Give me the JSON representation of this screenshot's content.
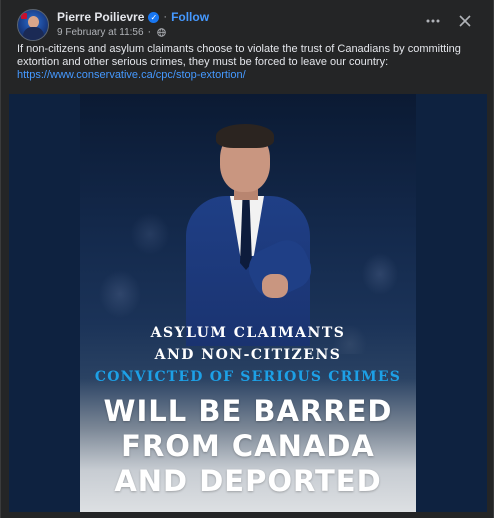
{
  "post": {
    "author": "Pierre Poilievre",
    "follow_label": "Follow",
    "date": "9 February at 11:56",
    "meta_separator": "·",
    "body_text": "If non-citizens and asylum claimants choose to violate the trust of Canadians by committing extortion and other serious crimes, they must be forced to leave our country:",
    "link": "https://www.conservative.ca/cpc/stop-extortion/"
  },
  "poster": {
    "line1": "ASYLUM CLAIMANTS",
    "line2": "AND NON-CITIZENS",
    "line3": "CONVICTED OF SERIOUS CRIMES",
    "line4": "WILL BE BARRED",
    "line5": "FROM CANADA",
    "line6": "AND DEPORTED"
  },
  "icons": {
    "more": "more-options-icon",
    "close": "close-icon",
    "verified": "verified-badge-icon",
    "audience": "globe-icon"
  },
  "colors": {
    "accent_link": "#4599ff",
    "poster_highlight": "#1da0e6",
    "background": "#242526"
  }
}
